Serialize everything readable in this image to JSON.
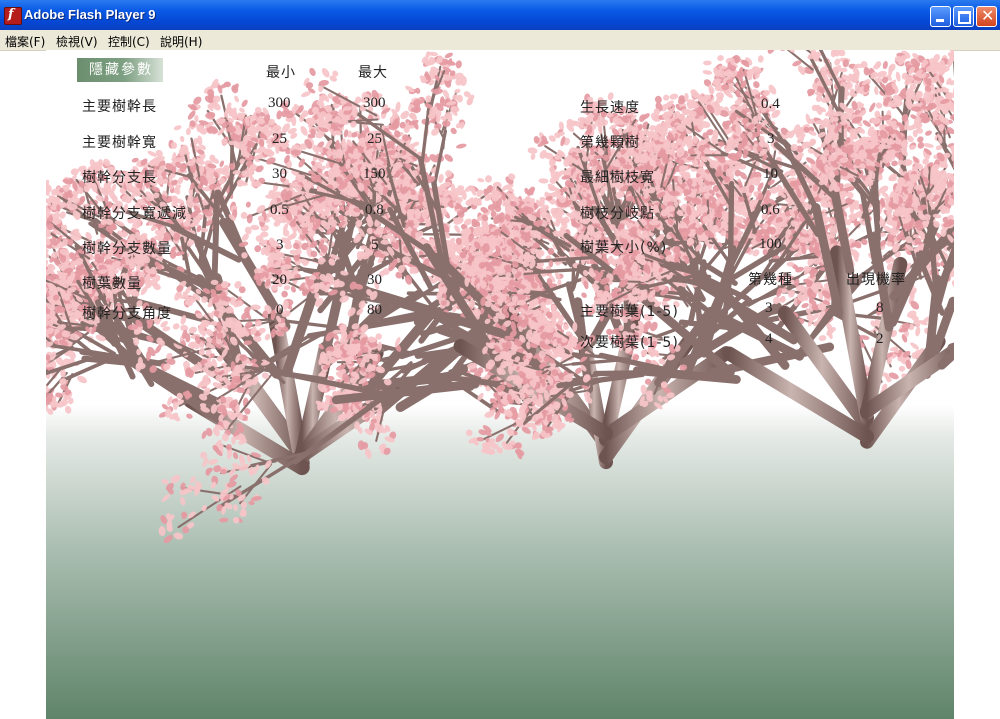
{
  "window": {
    "title": "Adobe Flash Player 9"
  },
  "menu": [
    "檔案(F)",
    "檢視(V)",
    "控制(C)",
    "說明(H)"
  ],
  "panel": {
    "hide_button": "隱藏參數",
    "col_min": "最小",
    "col_max": "最大",
    "rows": [
      {
        "label": "主要樹幹長",
        "min": "300",
        "max": "300"
      },
      {
        "label": "主要樹幹寬",
        "min": "25",
        "max": "25"
      },
      {
        "label": "樹幹分支長",
        "min": "30",
        "max": "150"
      },
      {
        "label": "樹幹分支寬遞減",
        "min": "0.5",
        "max": "0.8"
      },
      {
        "label": "樹幹分支數量",
        "min": "3",
        "max": "5"
      },
      {
        "label": "樹葉數量",
        "min": "20",
        "max": "30"
      },
      {
        "label": "樹幹分支角度",
        "min": "0",
        "max": "80"
      }
    ],
    "right_rows": [
      {
        "label": "生長速度",
        "value": "0.4"
      },
      {
        "label": "第幾顆樹",
        "value": "3"
      },
      {
        "label": "最細樹枝寬",
        "value": "10"
      },
      {
        "label": "樹枝分岐點",
        "value": "0.6"
      },
      {
        "label": "樹葉大小(%)",
        "value": "100"
      }
    ],
    "leaf_header_kind": "第幾種",
    "leaf_header_prob": "出現機率",
    "leaf_rows": [
      {
        "label": "主要樹葉(1-5)",
        "kind": "3",
        "prob": "8"
      },
      {
        "label": "次要樹葉(1-5)",
        "kind": "4",
        "prob": "2"
      }
    ]
  },
  "colors": {
    "blossom": "#f6c4c8",
    "blossom_dark": "#e59aa2",
    "bark_light": "#c9b4b0",
    "bark_dark": "#6e5450",
    "ground_dark": "#5f8469"
  }
}
